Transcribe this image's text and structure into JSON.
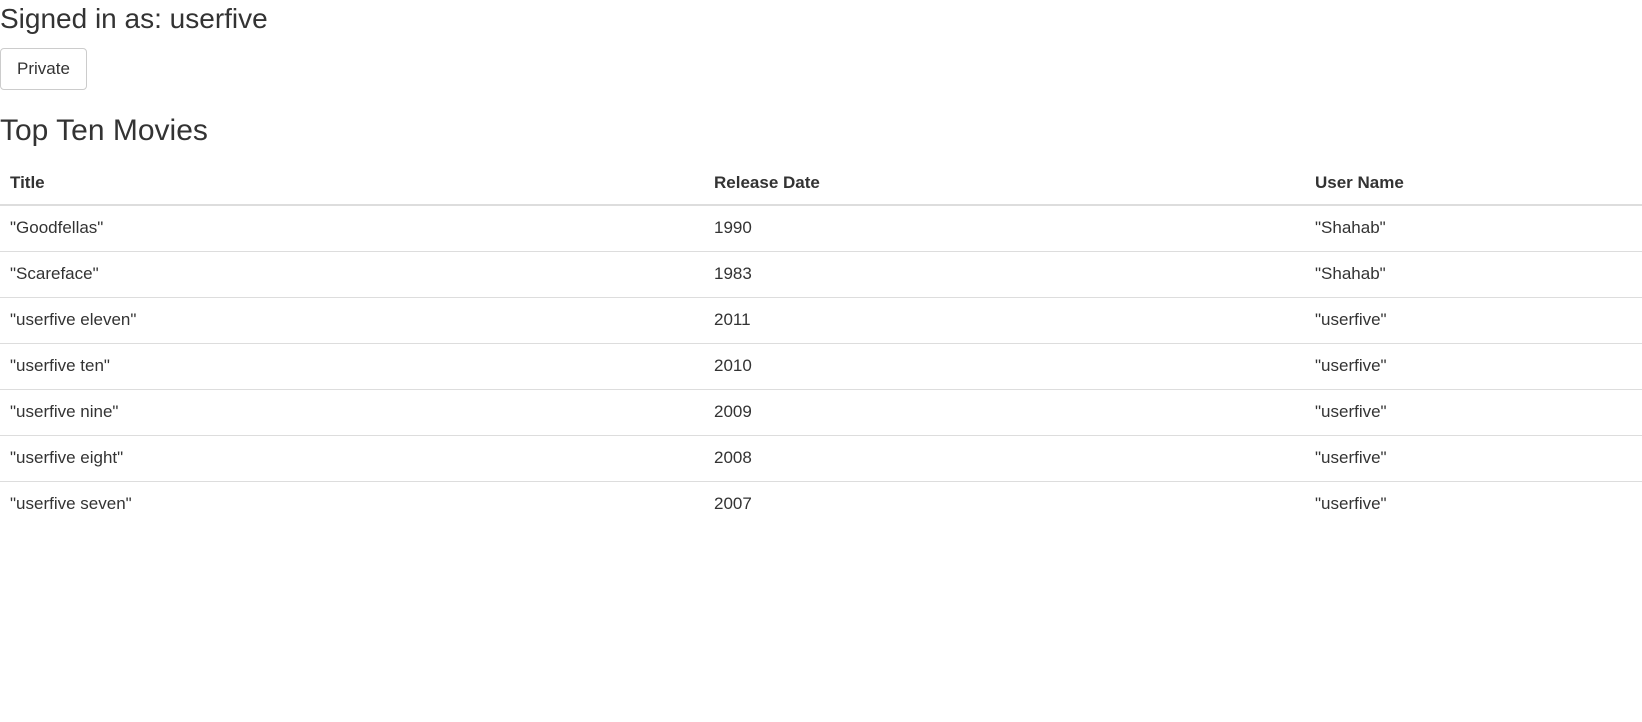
{
  "header": {
    "signed_in_text": "Signed in as: userfive",
    "private_button_label": "Private"
  },
  "section": {
    "title": "Top Ten Movies"
  },
  "table": {
    "columns": [
      "Title",
      "Release Date",
      "User Name"
    ],
    "rows": [
      {
        "title": "\"Goodfellas\"",
        "release_date": "1990",
        "user_name": "\"Shahab\""
      },
      {
        "title": "\"Scareface\"",
        "release_date": "1983",
        "user_name": "\"Shahab\""
      },
      {
        "title": "\"userfive eleven\"",
        "release_date": "2011",
        "user_name": "\"userfive\""
      },
      {
        "title": "\"userfive ten\"",
        "release_date": "2010",
        "user_name": "\"userfive\""
      },
      {
        "title": "\"userfive nine\"",
        "release_date": "2009",
        "user_name": "\"userfive\""
      },
      {
        "title": "\"userfive eight\"",
        "release_date": "2008",
        "user_name": "\"userfive\""
      },
      {
        "title": "\"userfive seven\"",
        "release_date": "2007",
        "user_name": "\"userfive\""
      }
    ]
  }
}
